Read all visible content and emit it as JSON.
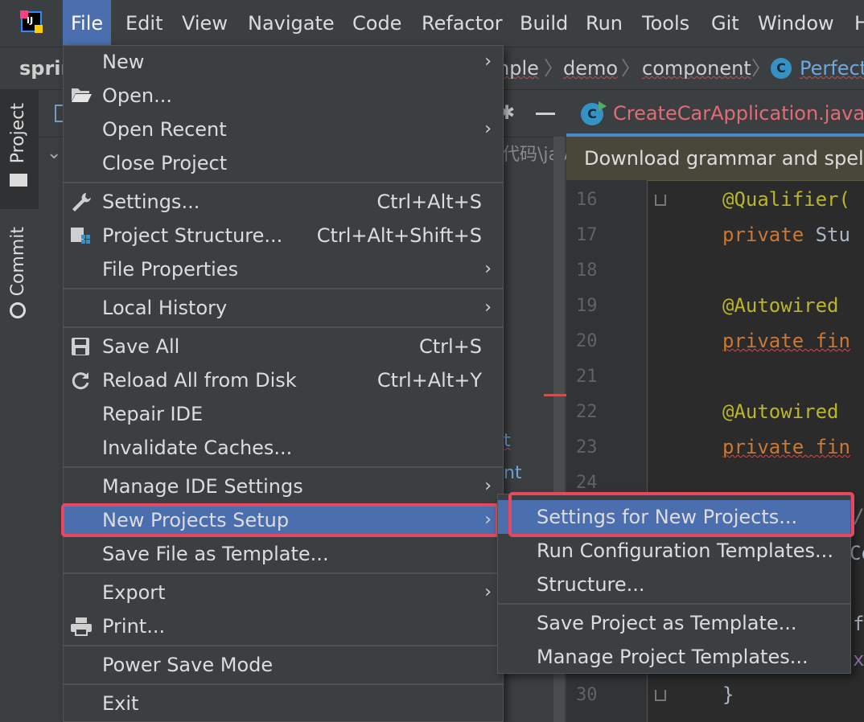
{
  "menubar": {
    "logo": "IJ",
    "items": [
      "File",
      "Edit",
      "View",
      "Navigate",
      "Code",
      "Refactor",
      "Build",
      "Run",
      "Tools",
      "Git",
      "Window",
      "H"
    ]
  },
  "breadcrumb": {
    "root": "sprir",
    "items": [
      "nple",
      "demo",
      "component"
    ],
    "class_icon": "C",
    "class_name": "Perfect"
  },
  "tool_stripe": {
    "project": "Project",
    "commit": "Commit"
  },
  "project_panel": {
    "path_fragment": "代码\\java",
    "text_fragment_1": "t",
    "text_fragment_2": "nt"
  },
  "editor": {
    "tab_icon": "C",
    "tab_title": "CreateCarApplication.java",
    "notification": "Download grammar and spelling",
    "lines": [
      {
        "n": "16",
        "parts": [
          {
            "t": "@Qualifier(",
            "c": "anno"
          }
        ]
      },
      {
        "n": "17",
        "parts": [
          {
            "t": "private ",
            "c": "kw"
          },
          {
            "t": "Stu",
            "c": "plain"
          }
        ]
      },
      {
        "n": "18",
        "parts": []
      },
      {
        "n": "19",
        "parts": [
          {
            "t": "@Autowired",
            "c": "anno"
          }
        ]
      },
      {
        "n": "20",
        "parts": [
          {
            "t": "private fin",
            "c": "kw"
          }
        ]
      },
      {
        "n": "21",
        "parts": []
      },
      {
        "n": "22",
        "parts": [
          {
            "t": "@Autowired",
            "c": "anno"
          }
        ]
      },
      {
        "n": "23",
        "parts": [
          {
            "t": "private fin",
            "c": "kw"
          }
        ]
      },
      {
        "n": "24",
        "parts": []
      },
      {
        "n": "30",
        "parts": [
          {
            "t": "}",
            "c": "plain"
          }
        ]
      }
    ],
    "edge_fragments": [
      "//",
      "Co",
      "f",
      "x"
    ]
  },
  "file_menu": {
    "items": [
      {
        "label": "New",
        "arrow": "›"
      },
      {
        "label": "Open...",
        "icon": "folder-open-icon"
      },
      {
        "label": "Open Recent",
        "arrow": "›"
      },
      {
        "label": "Close Project"
      },
      {
        "label": "Settings...",
        "shortcut": "Ctrl+Alt+S",
        "icon": "wrench-icon"
      },
      {
        "label": "Project Structure...",
        "shortcut": "Ctrl+Alt+Shift+S",
        "icon": "project-structure-icon"
      },
      {
        "label": "File Properties",
        "arrow": "›"
      },
      {
        "label": "Local History",
        "arrow": "›"
      },
      {
        "label": "Save All",
        "shortcut": "Ctrl+S",
        "icon": "save-icon"
      },
      {
        "label": "Reload All from Disk",
        "shortcut": "Ctrl+Alt+Y",
        "icon": "reload-icon"
      },
      {
        "label": "Repair IDE"
      },
      {
        "label": "Invalidate Caches..."
      },
      {
        "label": "Manage IDE Settings",
        "arrow": "›"
      },
      {
        "label": "New Projects Setup",
        "arrow": "›"
      },
      {
        "label": "Save File as Template..."
      },
      {
        "label": "Export",
        "arrow": "›"
      },
      {
        "label": "Print...",
        "icon": "print-icon"
      },
      {
        "label": "Power Save Mode"
      },
      {
        "label": "Exit"
      }
    ]
  },
  "submenu": {
    "items": [
      {
        "label": "Settings for New Projects..."
      },
      {
        "label": "Run Configuration Templates..."
      },
      {
        "label": "Structure..."
      },
      {
        "label": "Save Project as Template..."
      },
      {
        "label": "Manage Project Templates..."
      }
    ]
  },
  "colors": {
    "highlight": "#4b6eaf",
    "annotation_frame": "#e8475f",
    "annotation": "#bbb529",
    "keyword": "#cc7832"
  }
}
